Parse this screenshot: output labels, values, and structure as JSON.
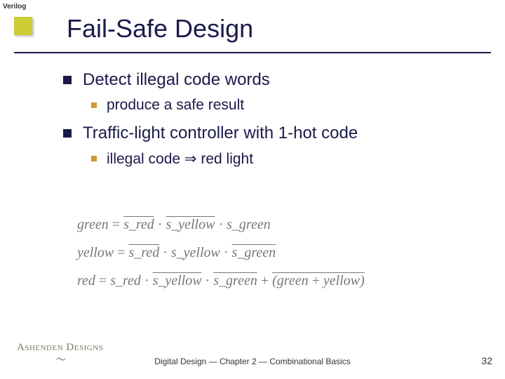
{
  "top_label": "Verilog",
  "title": "Fail-Safe Design",
  "bullets": {
    "b1a": "Detect illegal code words",
    "b2a": "produce a safe result",
    "b1b": "Traffic-light controller with 1-hot code",
    "b2b_left": "illegal code",
    "b2b_right": "red light"
  },
  "equations": {
    "row1_lhs": "green",
    "row1_a": "s_red",
    "row1_b": "s_yellow",
    "row1_c": "s_green",
    "row2_lhs": "yellow",
    "row2_a": "s_red",
    "row2_b": "s_yellow",
    "row2_c": "s_green",
    "row3_lhs": "red",
    "row3_a": "s_red",
    "row3_b": "s_yellow",
    "row3_c": "s_green",
    "row3_p1": "green",
    "row3_p2": "yellow"
  },
  "logo": "Ashenden Designs",
  "footer": "Digital Design — Chapter 2 — Combinational Basics",
  "page": "32"
}
